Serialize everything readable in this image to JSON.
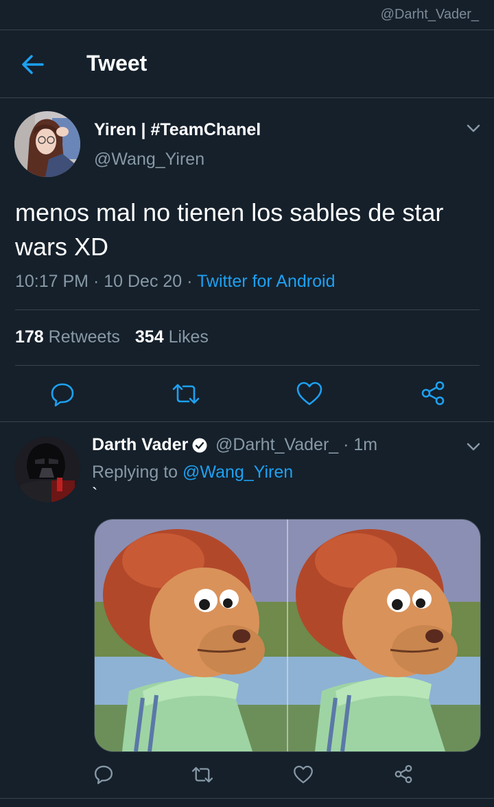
{
  "watermark": "@Darht_Vader_",
  "header": {
    "title": "Tweet"
  },
  "tweet": {
    "author_name": "Yiren | #TeamChanel",
    "author_handle": "@Wang_Yiren",
    "text": "menos mal no tienen los sables de star wars XD",
    "time": "10:17 PM",
    "date": "10 Dec 20",
    "source": "Twitter for Android",
    "retweet_count": "178",
    "retweet_label": "Retweets",
    "like_count": "354",
    "like_label": "Likes"
  },
  "reply": {
    "author_name": "Darth Vader",
    "author_handle": "@Darht_Vader_",
    "time_ago": "1m",
    "replying_label": "Replying to",
    "replying_to": "@Wang_Yiren",
    "text": "`"
  },
  "colors": {
    "background": "#15202b",
    "accent": "#1da1f2",
    "muted": "#8899a6",
    "border": "#38444d"
  },
  "icons": [
    "back-arrow-icon",
    "chevron-down-icon",
    "reply-icon",
    "retweet-icon",
    "like-icon",
    "share-icon",
    "verified-badge-icon"
  ]
}
